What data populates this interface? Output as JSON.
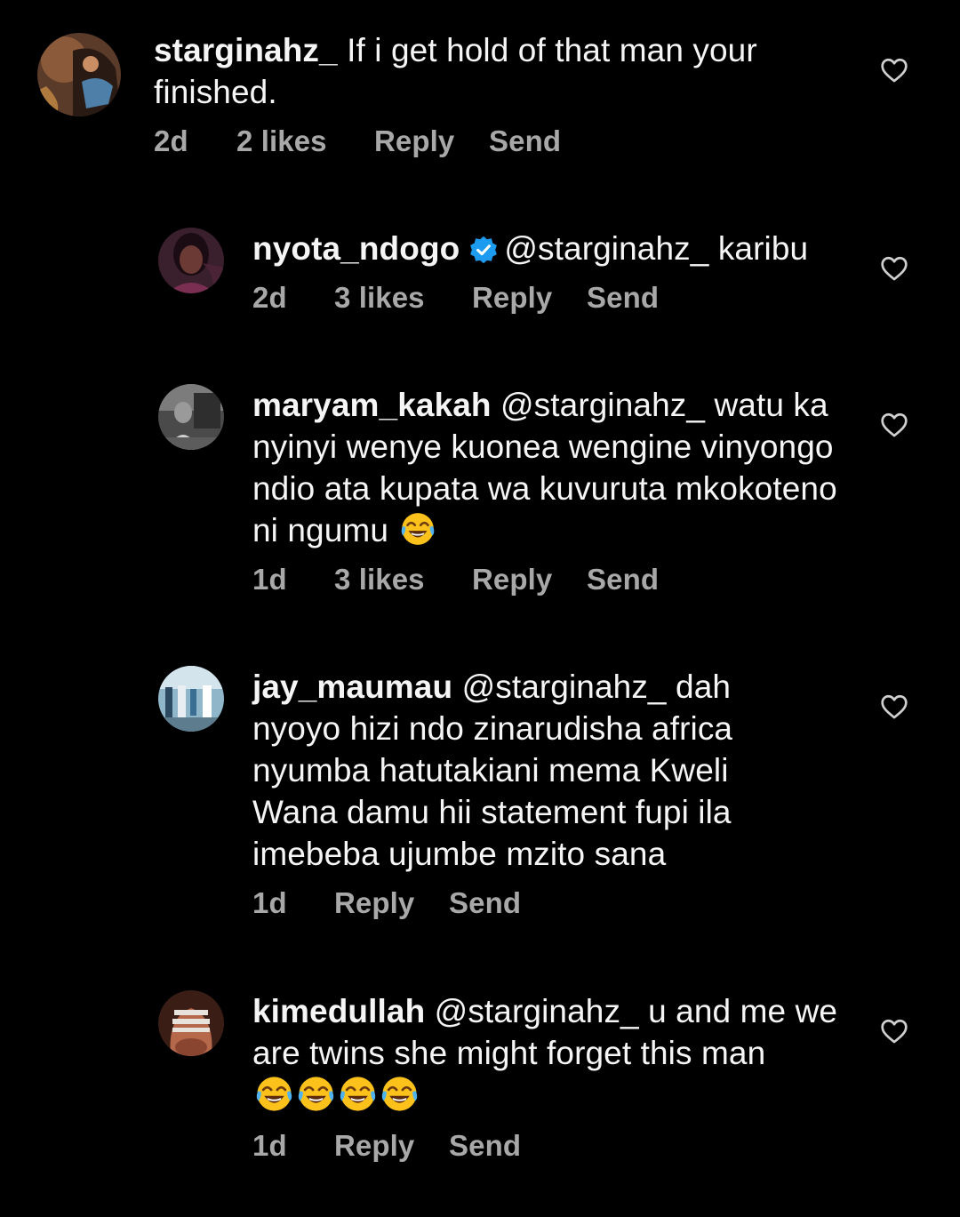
{
  "comments": [
    {
      "username": "starginahz_",
      "verified": false,
      "mention": "",
      "text": "If i get hold of that man your finished.",
      "time": "2d",
      "likes": "2 likes",
      "reply": "Reply",
      "send": "Send",
      "emojis": []
    },
    {
      "username": "nyota_ndogo",
      "verified": true,
      "mention": "@starginahz_",
      "text": "karibu",
      "time": "2d",
      "likes": "3 likes",
      "reply": "Reply",
      "send": "Send",
      "emojis": []
    },
    {
      "username": "maryam_kakah",
      "verified": false,
      "mention": "@starginahz_",
      "text": "watu ka nyinyi wenye kuonea wengine vinyongo  ndio ata kupata  wa kuvuruta mkokoteno ni ngumu",
      "time": "1d",
      "likes": "3 likes",
      "reply": "Reply",
      "send": "Send",
      "emojis": [
        "face-with-tears-of-joy"
      ]
    },
    {
      "username": "jay_maumau",
      "verified": false,
      "mention": "@starginahz_",
      "text": "dah nyoyo hizi ndo zinarudisha africa nyumba hatutakiani mema Kweli Wana damu hii statement fupi ila imebeba ujumbe mzito sana",
      "time": "1d",
      "likes": "",
      "reply": "Reply",
      "send": "Send",
      "emojis": []
    },
    {
      "username": "kimedullah",
      "verified": false,
      "mention": "@starginahz_",
      "text": "u and me we are twins she might forget this man",
      "time": "1d",
      "likes": "",
      "reply": "Reply",
      "send": "Send",
      "emojis": [
        "face-with-tears-of-joy",
        "face-with-tears-of-joy",
        "face-with-tears-of-joy",
        "face-with-tears-of-joy"
      ]
    }
  ],
  "icons": {
    "like": "heart-outline-icon",
    "verified": "verified-badge-icon",
    "emoji": "face-with-tears-of-joy"
  },
  "colors": {
    "background": "#000000",
    "text": "#f5f5f5",
    "meta": "#a8a8a8",
    "verified": "#1d9bf0"
  }
}
